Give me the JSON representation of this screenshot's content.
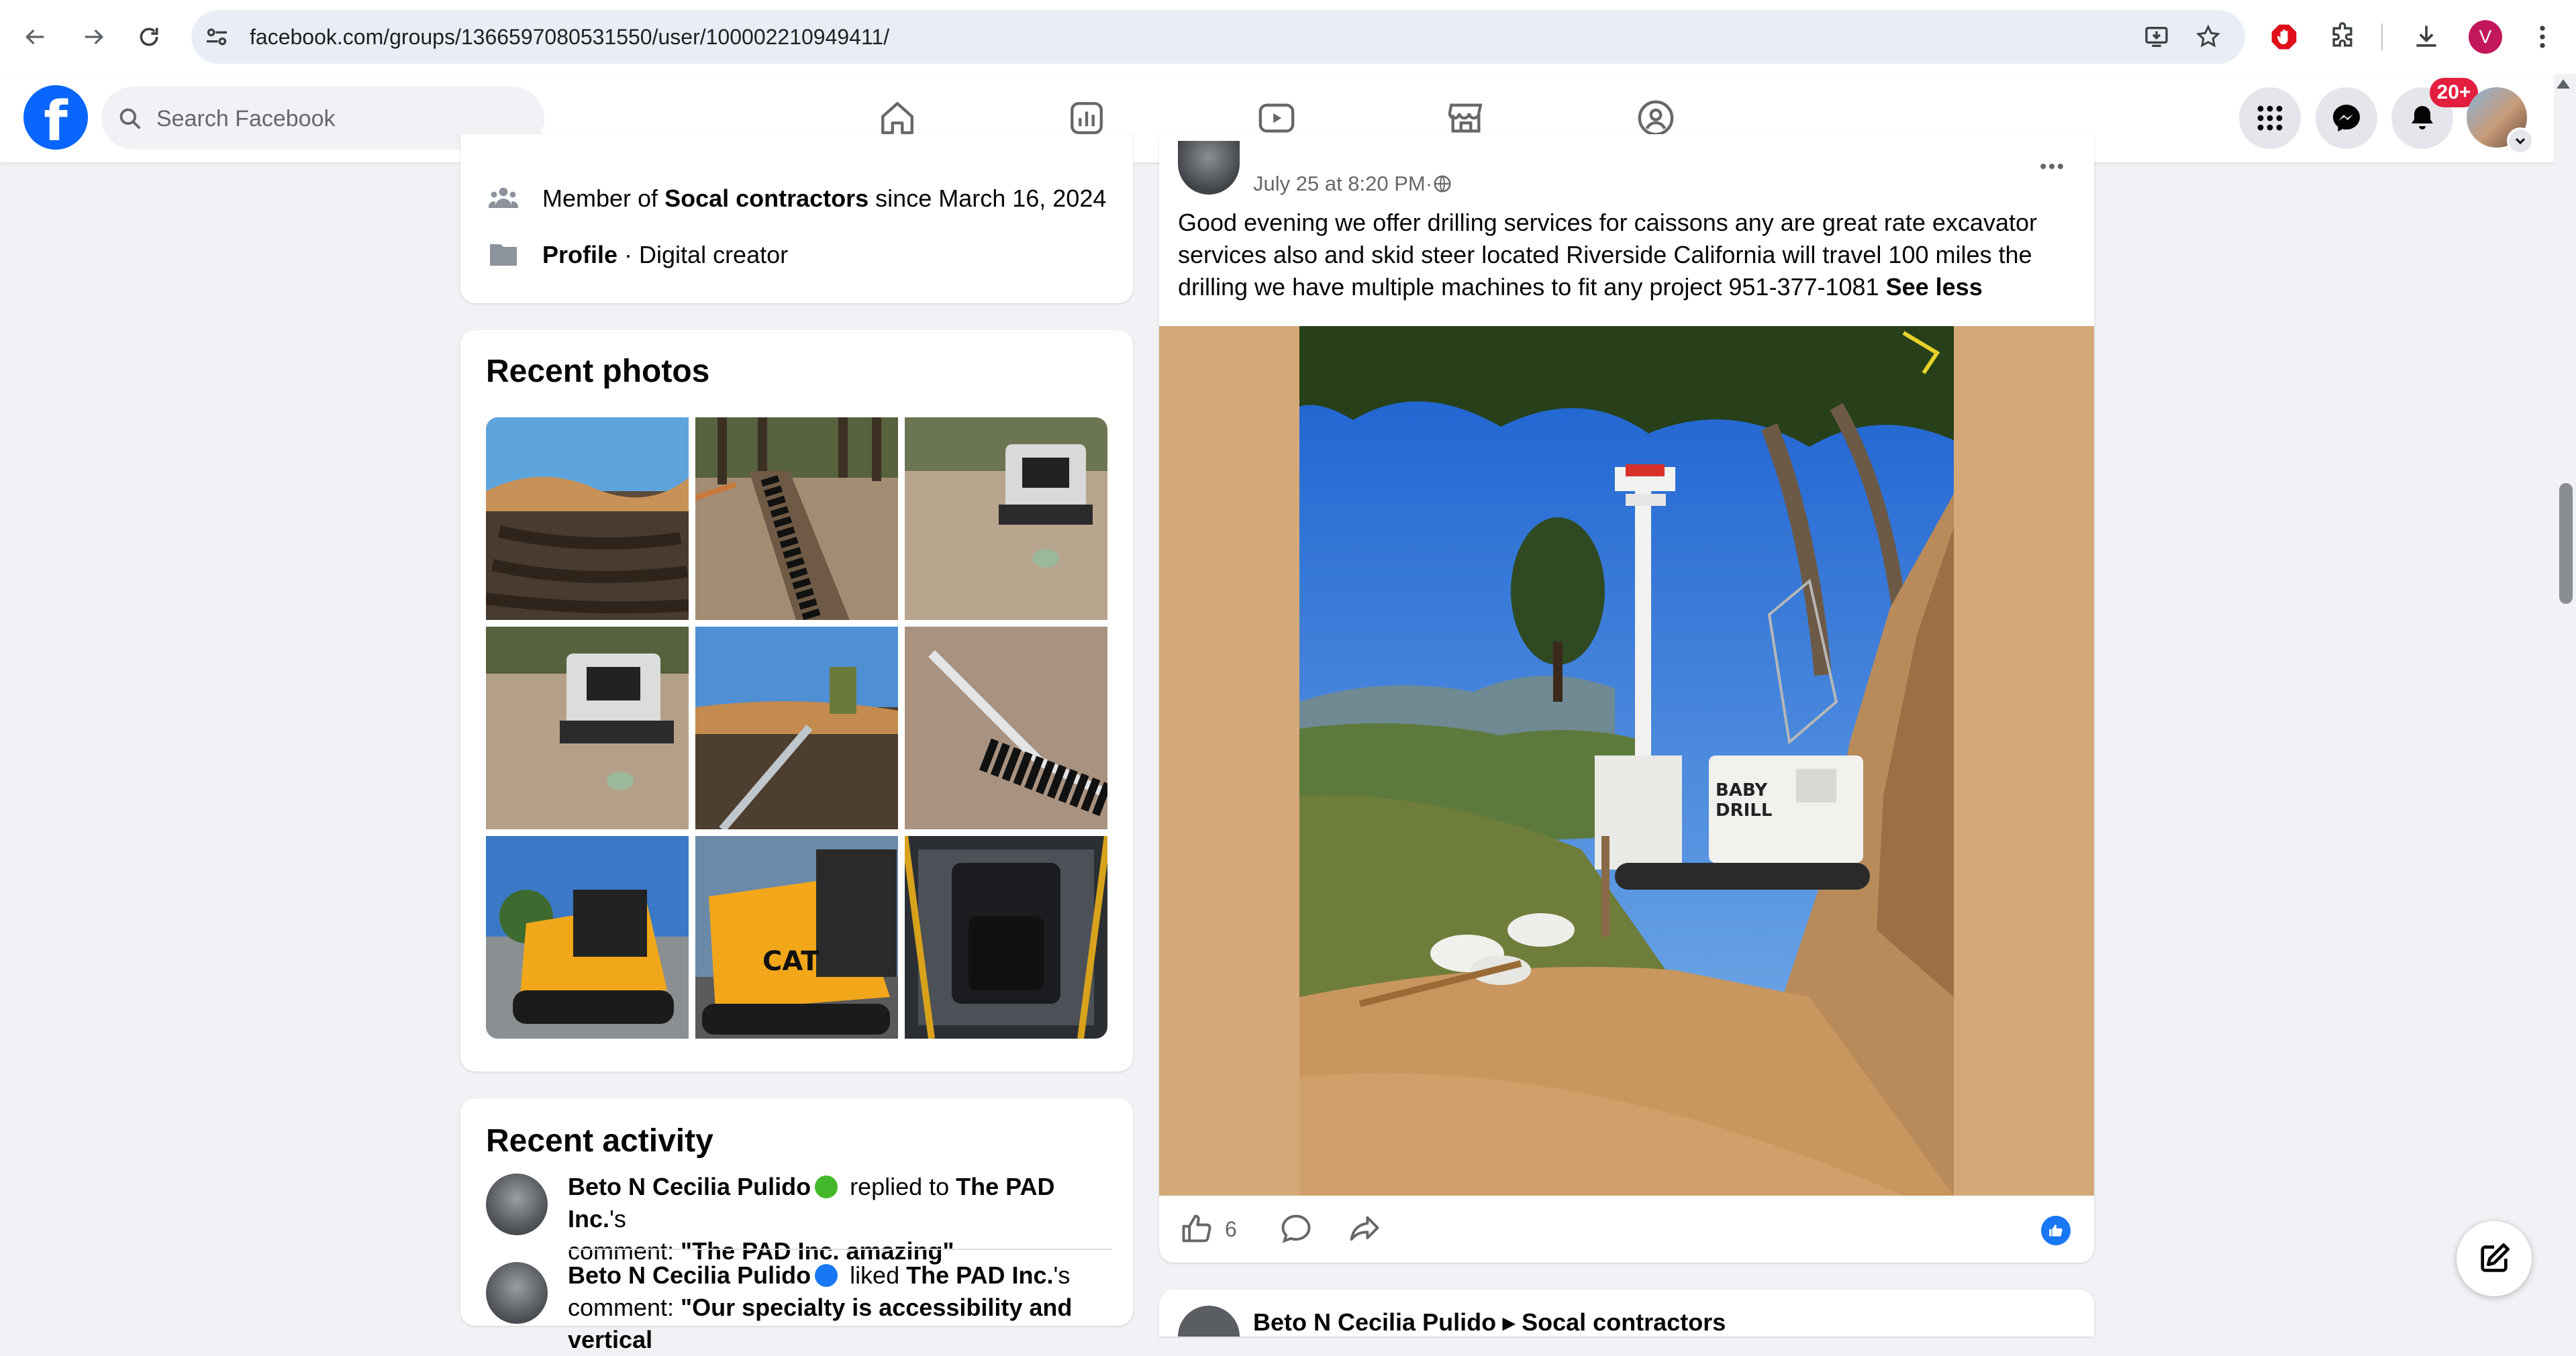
{
  "browser": {
    "url": "facebook.com/groups/1366597080531550/user/100002210949411/",
    "profile_initial": "V"
  },
  "header": {
    "search_placeholder": "Search Facebook",
    "notification_count": "20+",
    "brand_color": "#0866ff"
  },
  "intro": {
    "member_prefix": "Member of ",
    "group_name": "Socal contractors",
    "member_suffix": " since March 16, 2024",
    "profile_label": "Profile",
    "profile_sep": " · ",
    "profile_category": "Digital creator"
  },
  "recent_photos": {
    "title": "Recent photos"
  },
  "recent_activity": {
    "title": "Recent activity",
    "items": [
      {
        "actor": "Beto N Cecilia Pulido",
        "verb": " replied to ",
        "target": "The PAD Inc.",
        "suffix": "'s",
        "line2_prefix": "comment: ",
        "quote": "\"The PAD Inc. amazing\""
      },
      {
        "actor": "Beto N Cecilia Pulido",
        "verb": " liked ",
        "target": "The PAD Inc.",
        "suffix": "'s",
        "line2_prefix": "comment: ",
        "quote": "\"Our specialty is accessibility and vertical"
      }
    ]
  },
  "post": {
    "timestamp": "July 25 at 8:20 PM",
    "dot": " · ",
    "body": "Good evening we offer drilling services for caissons any are great rate excavator services also and skid steer located Riverside California will travel 100 miles the drilling we have multiple machines to fit any project 951-377-1081 ",
    "see_less": "See less",
    "like_count": "6",
    "image_text_1": "BABY",
    "image_text_2": "DRILL"
  },
  "next_post": {
    "header": "Beto N Cecilia Pulido ▸ Socal contractors"
  }
}
